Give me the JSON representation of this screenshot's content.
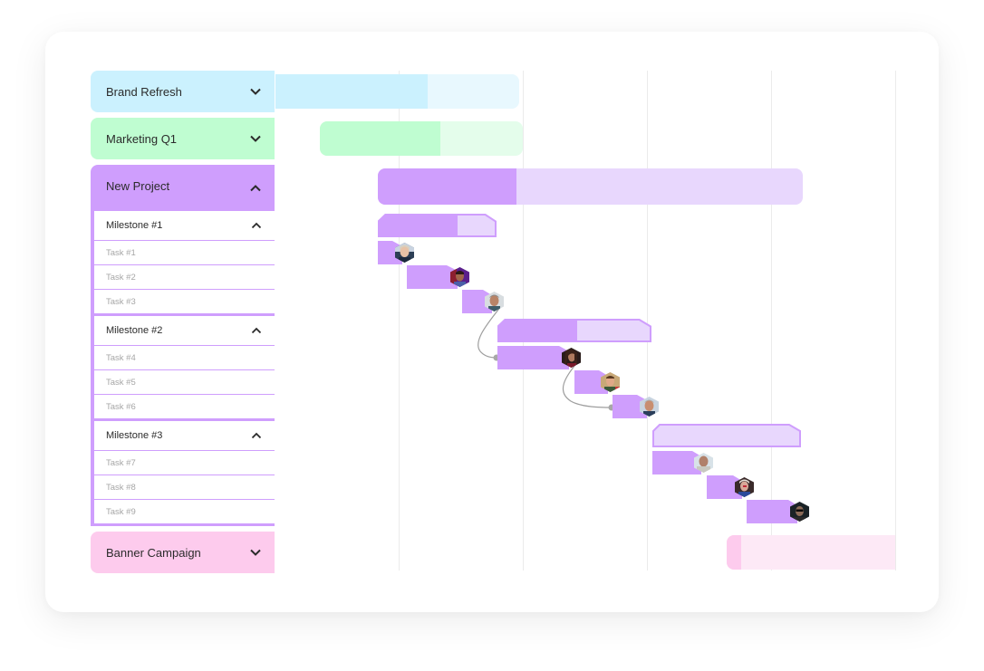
{
  "colors": {
    "brand_refresh": {
      "row": "#cbf1fe",
      "done": "#cbf1fe",
      "remaining": "#e8f8fe"
    },
    "marketing_q1": {
      "row": "#bffdd1",
      "done": "#bffdd1",
      "remaining": "#e4fdeb"
    },
    "new_project": {
      "row": "#cf9efd",
      "done": "#cf9efd",
      "remaining": "#e8d7fd",
      "border": "#cf9efd"
    },
    "banner_campaign": {
      "row": "#fdcbed",
      "done": "#fdcbed",
      "remaining": "#fde9f6"
    },
    "gridline": "#ebebeb",
    "connector": "#9e9e9e"
  },
  "projects": [
    {
      "id": "brand-refresh",
      "label": "Brand Refresh",
      "expanded": false,
      "progress": 0.63
    },
    {
      "id": "marketing-q1",
      "label": "Marketing Q1",
      "expanded": false,
      "progress": 0.59
    },
    {
      "id": "new-project",
      "label": "New Project",
      "expanded": true,
      "progress": 0.33
    },
    {
      "id": "banner-campaign",
      "label": "Banner Campaign",
      "expanded": false,
      "progress": 0.09
    }
  ],
  "milestones": [
    {
      "label": "Milestone #1",
      "expanded": true,
      "progress": 0.67,
      "tasks": [
        {
          "label": "Task #1",
          "avatar": "avatar-1"
        },
        {
          "label": "Task #2",
          "avatar": "avatar-2"
        },
        {
          "label": "Task #3",
          "avatar": "avatar-3"
        }
      ]
    },
    {
      "label": "Milestone #2",
      "expanded": true,
      "progress": 0.52,
      "tasks": [
        {
          "label": "Task #4",
          "avatar": "avatar-4"
        },
        {
          "label": "Task #5",
          "avatar": "avatar-5"
        },
        {
          "label": "Task #6",
          "avatar": "avatar-6"
        }
      ]
    },
    {
      "label": "Milestone #3",
      "expanded": true,
      "progress": 0.0,
      "tasks": [
        {
          "label": "Task #7",
          "avatar": "avatar-7"
        },
        {
          "label": "Task #8",
          "avatar": "avatar-8"
        },
        {
          "label": "Task #9",
          "avatar": "avatar-9"
        }
      ]
    }
  ],
  "dependencies": [
    {
      "from": "Task #3",
      "to": "Task #4"
    },
    {
      "from": "Task #4",
      "to": "Task #6"
    }
  ],
  "icons": {
    "collapsed": "chevron-down-icon",
    "expanded": "chevron-up-icon"
  }
}
